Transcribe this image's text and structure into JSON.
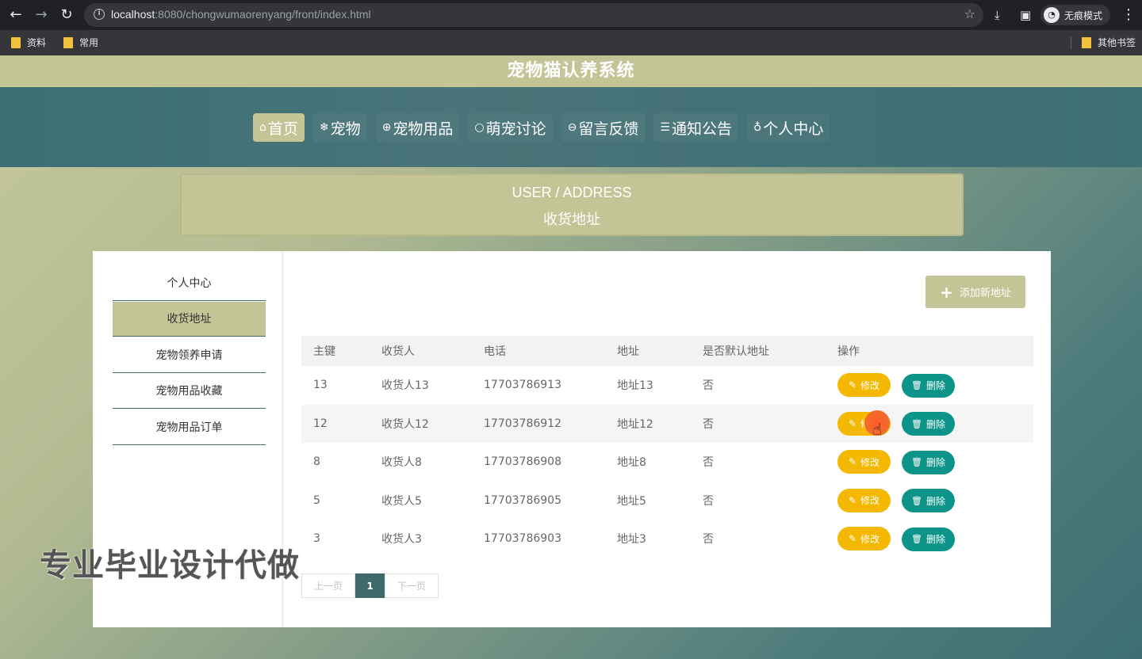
{
  "browser": {
    "url_host": "localhost",
    "url_rest": ":8080/chongwumaorenyang/front/index.html",
    "incognito_label": "无痕模式",
    "bookmarks": [
      "资料",
      "常用"
    ],
    "other_bookmarks": "其他书签"
  },
  "site": {
    "title": "宠物猫认养系统",
    "nav": [
      {
        "icon": "⌂",
        "label": "首页",
        "active": true
      },
      {
        "icon": "❄",
        "label": "宠物"
      },
      {
        "icon": "⊕",
        "label": "宠物用品"
      },
      {
        "icon": "○",
        "label": "萌宠讨论"
      },
      {
        "icon": "⊖",
        "label": "留言反馈"
      },
      {
        "icon": "☰",
        "label": "通知公告"
      },
      {
        "icon": "♁",
        "label": "个人中心"
      }
    ]
  },
  "breadcrumb": {
    "en": "USER / ADDRESS",
    "zh": "收货地址"
  },
  "sidebar": {
    "items": [
      {
        "label": "个人中心"
      },
      {
        "label": "收货地址",
        "active": true
      },
      {
        "label": "宠物领养申请"
      },
      {
        "label": "宠物用品收藏"
      },
      {
        "label": "宠物用品订单"
      }
    ]
  },
  "main": {
    "add_button": "添加新地址",
    "columns": [
      "主键",
      "收货人",
      "电话",
      "地址",
      "是否默认地址",
      "操作"
    ],
    "rows": [
      {
        "id": "13",
        "name": "收货人13",
        "phone": "17703786913",
        "address": "地址13",
        "default": "否"
      },
      {
        "id": "12",
        "name": "收货人12",
        "phone": "17703786912",
        "address": "地址12",
        "default": "否"
      },
      {
        "id": "8",
        "name": "收货人8",
        "phone": "17703786908",
        "address": "地址8",
        "default": "否"
      },
      {
        "id": "5",
        "name": "收货人5",
        "phone": "17703786905",
        "address": "地址5",
        "default": "否"
      },
      {
        "id": "3",
        "name": "收货人3",
        "phone": "17703786903",
        "address": "地址3",
        "default": "否"
      }
    ],
    "edit_label": "修改",
    "delete_label": "删除",
    "pager": {
      "prev": "上一页",
      "current": "1",
      "next": "下一页"
    }
  },
  "watermark": "专业毕业设计代做",
  "colors": {
    "accent": "#c4c596",
    "teal": "#3e6a6c",
    "edit": "#f5b800",
    "delete": "#0d9488"
  }
}
